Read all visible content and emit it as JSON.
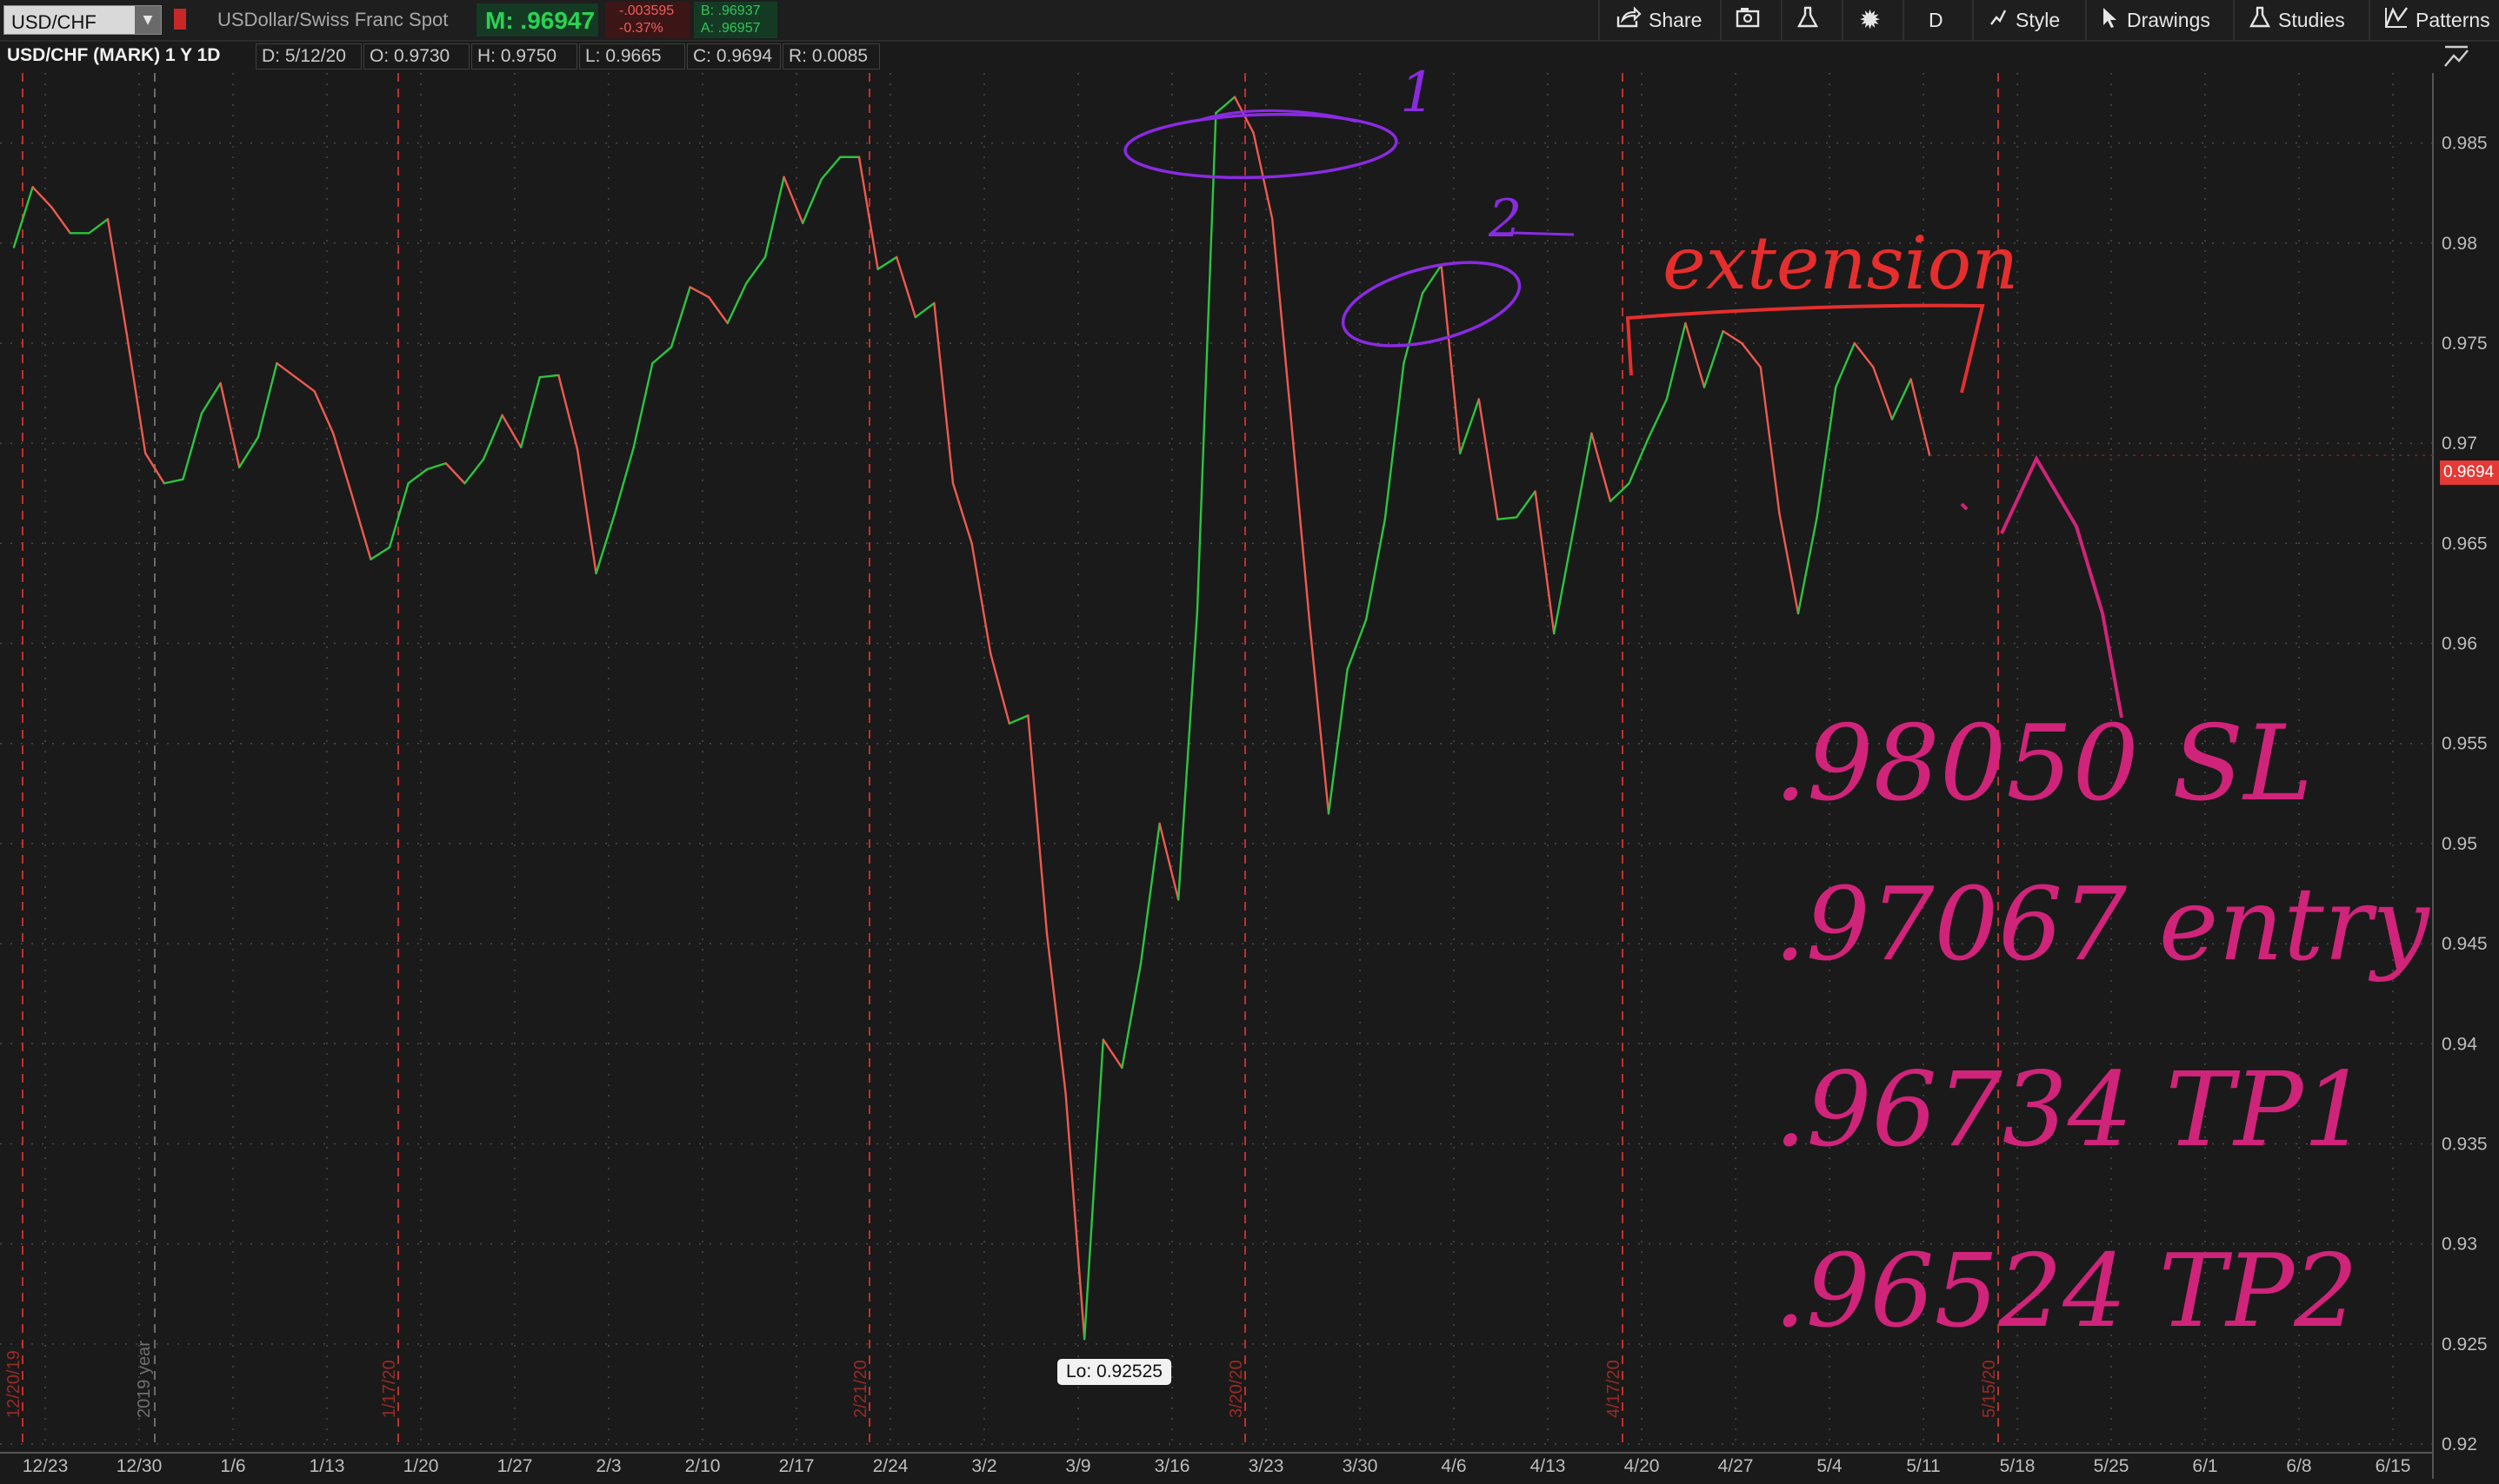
{
  "toolbar": {
    "symbol": "USD/CHF",
    "description": "USDollar/Swiss Franc Spot",
    "mark": "M: .96947",
    "net_change": "-.003595",
    "pct_change": "-0.37%",
    "bid": "B: .96937",
    "ask": "A: .96957",
    "share_label": "Share",
    "aggregation_label": "D",
    "style_label": "Style",
    "drawings_label": "Drawings",
    "studies_label": "Studies",
    "patterns_label": "Patterns"
  },
  "info": {
    "title": "USD/CHF (MARK) 1 Y 1D",
    "date": "D: 5/12/20",
    "open": "O: 0.9730",
    "high": "H: 0.9750",
    "low": "L: 0.9665",
    "close": "C: 0.9694",
    "range": "R: 0.0085"
  },
  "low_bubble": "Lo: 0.92525",
  "last_price_label": "0.9694",
  "year_marker": "2019 year",
  "expiration_labels": [
    "12/20/19",
    "1/17/20",
    "2/21/20",
    "3/20/20",
    "4/17/20",
    "5/15/20"
  ],
  "chart_data": {
    "type": "line",
    "title": "USD/CHF (MARK) 1 Y 1D",
    "x_tick_labels": [
      "12/23",
      "12/30",
      "1/6",
      "1/13",
      "1/20",
      "1/27",
      "2/3",
      "2/10",
      "2/17",
      "2/24",
      "3/2",
      "3/9",
      "3/16",
      "3/23",
      "3/30",
      "4/6",
      "4/13",
      "4/20",
      "4/27",
      "5/4",
      "5/11",
      "5/18",
      "5/25",
      "6/1",
      "6/8",
      "6/15"
    ],
    "y_tick_labels": [
      "0.985",
      "0.98",
      "0.975",
      "0.97",
      "0.965",
      "0.96",
      "0.955",
      "0.95",
      "0.945",
      "0.94",
      "0.935",
      "0.93",
      "0.925",
      "0.92"
    ],
    "ylim": [
      0.92,
      0.9885
    ],
    "grid": true,
    "up_color": "#2bc53f",
    "down_color": "#ef5a4f",
    "values": [
      0.9798,
      0.9828,
      0.9818,
      0.9805,
      0.9805,
      0.9812,
      0.9755,
      0.9695,
      0.968,
      0.9682,
      0.9715,
      0.973,
      0.9688,
      0.9703,
      0.974,
      0.9733,
      0.9726,
      0.9705,
      0.9674,
      0.9642,
      0.9648,
      0.968,
      0.9687,
      0.969,
      0.968,
      0.9692,
      0.9714,
      0.9698,
      0.9733,
      0.9734,
      0.9697,
      0.9635,
      0.9665,
      0.9698,
      0.974,
      0.9748,
      0.9778,
      0.9773,
      0.976,
      0.978,
      0.9793,
      0.9833,
      0.981,
      0.9832,
      0.9843,
      0.9843,
      0.9787,
      0.9793,
      0.9763,
      0.977,
      0.968,
      0.965,
      0.9595,
      0.956,
      0.9564,
      0.9455,
      0.9375,
      0.92525,
      0.9402,
      0.9388,
      0.944,
      0.951,
      0.9472,
      0.9615,
      0.9865,
      0.9873,
      0.9855,
      0.9812,
      0.9712,
      0.9609,
      0.9515,
      0.9587,
      0.9612,
      0.9662,
      0.974,
      0.9775,
      0.9789,
      0.9695,
      0.9722,
      0.9662,
      0.9663,
      0.9676,
      0.9605,
      0.9655,
      0.9705,
      0.9671,
      0.968,
      0.9702,
      0.9722,
      0.976,
      0.9728,
      0.9756,
      0.975,
      0.9738,
      0.9665,
      0.9615,
      0.9663,
      0.9728,
      0.975,
      0.9738,
      0.9712,
      0.9732,
      0.9694
    ]
  },
  "annotations": {
    "peak1_label": "1",
    "peak2_label": "2",
    "extension_label": "extension",
    "sl_line": ".98050 SL",
    "entry_line": ".97067 entry",
    "tp1_line": ".96734 TP1",
    "tp2_line": ".96524 TP2"
  },
  "colors": {
    "annotation_magenta": "#d0247a",
    "annotation_red": "#e62e2e",
    "annotation_purple": "#8a2be2",
    "expiration_line": "#c0302b"
  }
}
